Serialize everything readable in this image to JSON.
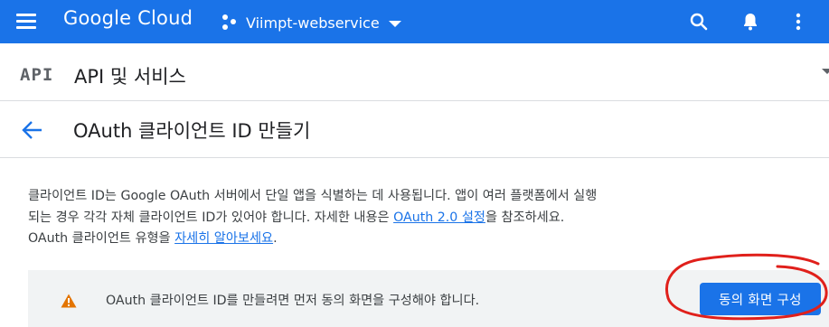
{
  "topbar": {
    "logo_text": "Google Cloud",
    "project_name": "Viimpt-webservice",
    "colors": {
      "bar": "#1a73e8"
    },
    "icons": [
      "menu-icon",
      "project-dots-icon",
      "chevron-down-icon",
      "search-icon",
      "bell-icon",
      "more-vert-icon"
    ]
  },
  "section": {
    "logo_text": "API",
    "title": "API 및 서비스"
  },
  "page": {
    "title": "OAuth 클라이언트 ID 만들기"
  },
  "description": {
    "part1": "클라이언트 ID는 Google OAuth 서버에서 단일 앱을 식별하는 데 사용됩니다. 앱이 여러 플랫폼에서 실행되는 경우 각각 자체 클라이언트 ID가 있어야 합니다. 자세한 내용은 ",
    "link1": "OAuth 2.0 설정",
    "part2": "을 참조하세요. OAuth 클라이언트 유형을 ",
    "link2": "자세히 알아보세요",
    "part3": "."
  },
  "banner": {
    "message": "OAuth 클라이언트 ID를 만들려면 먼저 동의 화면을 구성해야 합니다.",
    "button_label": "동의 화면 구성",
    "warning_color": "#e37400"
  },
  "annotation": {
    "color": "#e0201b"
  }
}
